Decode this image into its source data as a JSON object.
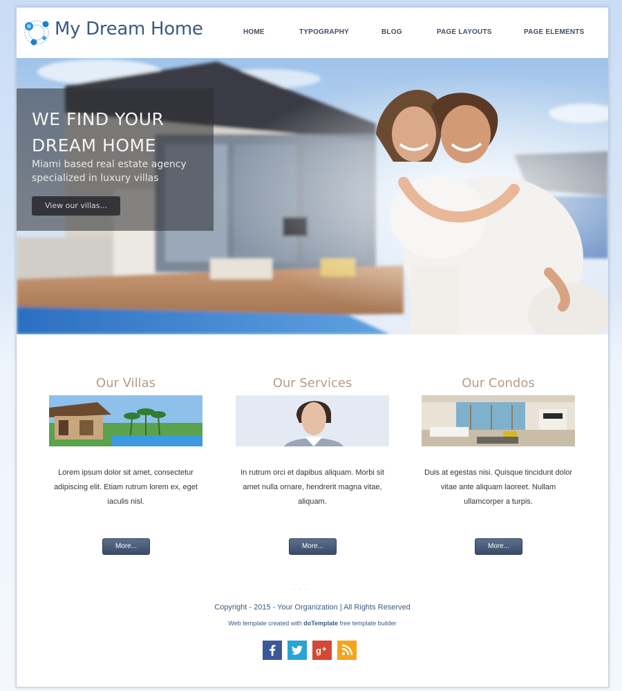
{
  "header": {
    "site_title": "My Dream Home",
    "nav": [
      {
        "label": "HOME"
      },
      {
        "label": "TYPOGRAPHY"
      },
      {
        "label": "BLOG"
      },
      {
        "label": "PAGE LAYOUTS"
      },
      {
        "label": "PAGE ELEMENTS"
      }
    ]
  },
  "hero": {
    "headline_line1": "WE FIND YOUR",
    "headline_line2": "DREAM HOME",
    "subtitle_line1": "Miami based real estate agency",
    "subtitle_line2": "specialized in luxury villas",
    "button_label": "View our villas..."
  },
  "features": [
    {
      "title": "Our Villas",
      "text": "Lorem ipsum dolor sit amet, consectetur adipiscing elit. Etiam rutrum lorem ex, eget iaculis nisl.",
      "button_label": "More..."
    },
    {
      "title": "Our Services",
      "text": "In rutrum orci et dapibus aliquam. Morbi sit amet nulla ornare, hendrerit magna vitae, aliquam.",
      "button_label": "More..."
    },
    {
      "title": "Our Condos",
      "text": "Duis at egestas nisi. Quisque tincidunt dolor vitae ante aliquam laoreet. Nullam ullamcorper a turpis.",
      "button_label": "More..."
    }
  ],
  "footer": {
    "copyright": "Copyright - 2015 - Your Organization | All Rights Reserved",
    "credit_prefix": "Web template created with ",
    "credit_brand": "doTemplate",
    "credit_suffix": " free template builder",
    "socials": [
      {
        "icon": "facebook-icon",
        "color": "#3b5998"
      },
      {
        "icon": "twitter-icon",
        "color": "#2aa3d8"
      },
      {
        "icon": "google-plus-icon",
        "color": "#d34836"
      },
      {
        "icon": "rss-icon",
        "color": "#f7a21b"
      }
    ]
  },
  "colors": {
    "title_blue": "#3a5a82",
    "feature_title": "#b89a88",
    "button_dark": "#3a4c69"
  }
}
